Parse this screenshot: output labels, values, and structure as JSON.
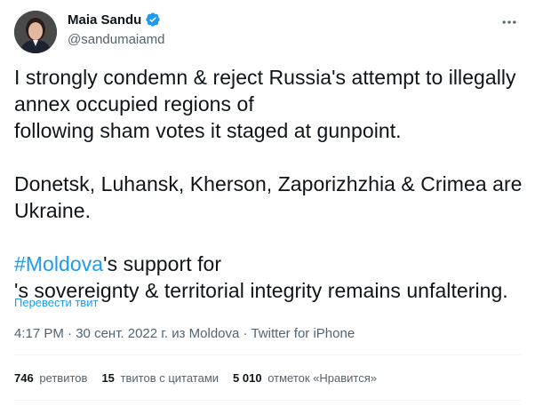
{
  "author": {
    "display_name": "Maia Sandu",
    "handle": "@sandumaiamd",
    "verified": true
  },
  "tweet": {
    "paragraph1_part1": "I strongly condemn & reject Russia's attempt to illegally annex occupied regions of",
    "paragraph1_part2": " following sham votes it staged at gunpoint.",
    "paragraph2": "Donetsk, Luhansk, Kherson, Zaporizhzhia & Crimea are Ukraine.",
    "hashtag": "#Moldova",
    "paragraph3_part1": "'s support for ",
    "paragraph3_part2": "'s sovereignty & territorial integrity remains unfaltering."
  },
  "translate_label": "Перевести твит",
  "meta": {
    "time": "4:17 PM",
    "date": "30 сент. 2022 г. из Moldova",
    "separator": " · ",
    "source": "Twitter for iPhone"
  },
  "stats": {
    "retweets_count": "746",
    "retweets_label": "ретвитов",
    "quotes_count": "15",
    "quotes_label": "твитов с цитатами",
    "likes_count": "5 010",
    "likes_label": "отметок «Нравится»"
  },
  "icons": {
    "verified": "verified-badge-icon",
    "more": "more-options-icon",
    "flag": "ukraine-flag-emoji"
  },
  "colors": {
    "accent": "#1d9bf0",
    "text": "#0f1419",
    "secondary": "#536471",
    "flag_blue": "#0057b7",
    "flag_yellow": "#ffd700"
  }
}
